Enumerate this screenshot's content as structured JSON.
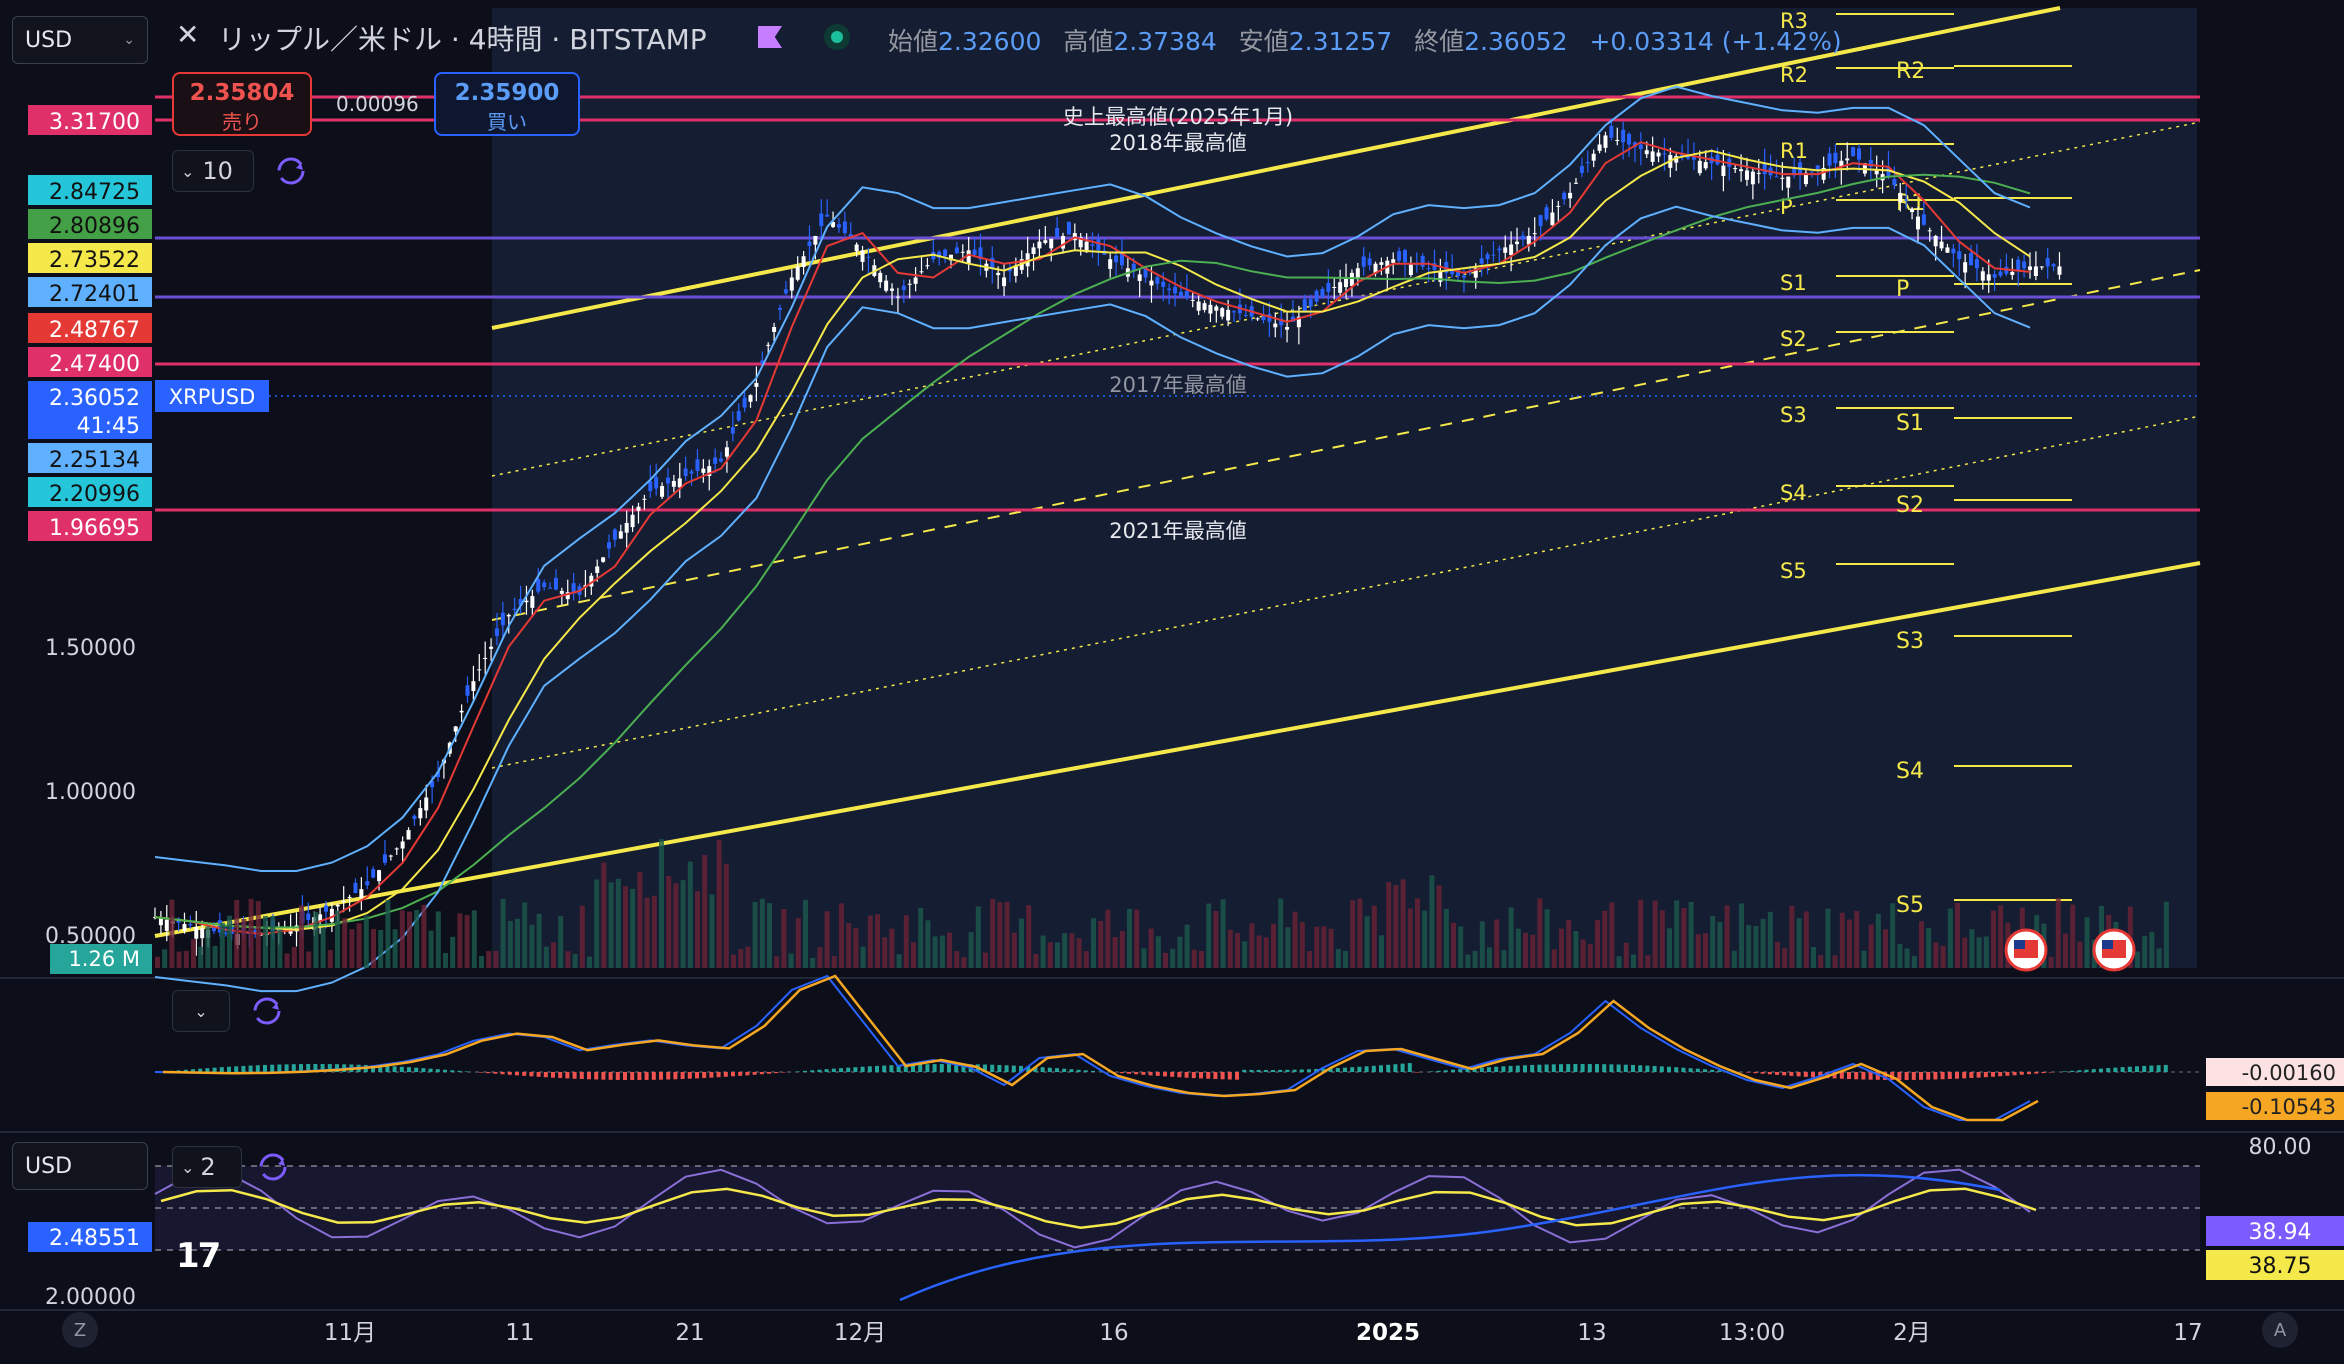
{
  "header": {
    "currency": "USD",
    "title": "リップル／米ドル · 4時間 · BITSTAMP",
    "ohlc": {
      "open_label": "始値",
      "open": "2.32600",
      "high_label": "高値",
      "high": "2.37384",
      "low_label": "安値",
      "low": "2.31257",
      "close_label": "終値",
      "close": "2.36052",
      "change": "+0.03314 (+1.42%)"
    },
    "sell": {
      "price": "2.35804",
      "label": "売り"
    },
    "buy": {
      "price": "2.35900",
      "label": "買い"
    },
    "spread": "0.00096",
    "interval_count": "10",
    "osc_currency": "USD",
    "osc_count": "2"
  },
  "colors": {
    "background": "#0c0f1a",
    "channel_line": "#f5e84a",
    "red_line": "#e0306a",
    "purple_line": "#6a4fd6",
    "bollinger": "#5fb0ff",
    "sma_fast": "#e53935",
    "sma_mid": "#f5e84a",
    "sma_slow": "#4caf50",
    "macd_signal": "#f5a623",
    "rsi": "#8a6fd6",
    "accent_blue": "#2962ff"
  },
  "chart_data": {
    "type": "candlestick",
    "symbol": "XRPUSD",
    "y_scale": "log",
    "y_ticks": [
      {
        "label": "3.31700",
        "value": 3.317,
        "color": "#e0306a"
      },
      {
        "label": "2.84725",
        "value": 2.84725,
        "color": "#26c6da"
      },
      {
        "label": "2.80896",
        "value": 2.80896,
        "color": "#43a047"
      },
      {
        "label": "2.73522",
        "value": 2.73522,
        "color": "#f5e84a"
      },
      {
        "label": "2.72401",
        "value": 2.72401,
        "color": "#5fb0ff"
      },
      {
        "label": "2.48767",
        "value": 2.48767,
        "color": "#e53935"
      },
      {
        "label": "2.47400",
        "value": 2.474,
        "color": "#e0306a"
      },
      {
        "label": "2.36052",
        "value": 2.36052,
        "color": "#2962ff"
      },
      {
        "label": "41:45",
        "value": 2.29,
        "color": "#2962ff"
      },
      {
        "label": "2.25134",
        "value": 2.25134,
        "color": "#5fb0ff"
      },
      {
        "label": "2.20996",
        "value": 2.20996,
        "color": "#26c6da"
      },
      {
        "label": "1.96695",
        "value": 1.96695,
        "color": "#e0306a"
      },
      {
        "label": "1.50000",
        "value": 1.5,
        "color": ""
      },
      {
        "label": "1.00000",
        "value": 1.0,
        "color": ""
      },
      {
        "label": "0.50000",
        "value": 0.5,
        "color": ""
      }
    ],
    "volume_label": "1.26 M",
    "x_ticks": [
      "11月",
      "11",
      "21",
      "12月",
      "16",
      "2025",
      "13",
      "13:00",
      "2月",
      "17"
    ],
    "horizontal_levels": [
      {
        "value": 3.317,
        "label": "史上最高値(2025年1月)",
        "color": "#e0306a"
      },
      {
        "value": 3.2,
        "label": "2018年最高値",
        "color": "#e0306a"
      },
      {
        "value": 2.85,
        "label": "",
        "color": "#6a4fd6"
      },
      {
        "value": 2.72,
        "label": "",
        "color": "#6a4fd6"
      },
      {
        "value": 2.474,
        "label": "2017年最高値",
        "color": "#e0306a"
      },
      {
        "value": 1.967,
        "label": "2021年最高値",
        "color": "#e0306a"
      }
    ],
    "pivot_labels": {
      "set1": [
        "R3",
        "R2",
        "R1",
        "P",
        "S1",
        "S2",
        "S3",
        "S4",
        "S5"
      ],
      "set2": [
        "R2",
        "R1",
        "P",
        "S1",
        "S2",
        "S3",
        "S4",
        "S5"
      ]
    },
    "series": [
      {
        "name": "XRPUSD",
        "close": [
          0.52,
          0.51,
          0.5,
          0.5,
          0.51,
          0.53,
          0.56,
          0.62,
          0.72,
          0.9,
          1.05,
          1.12,
          1.1,
          1.25,
          1.4,
          1.45,
          1.5,
          1.8,
          2.3,
          2.65,
          2.45,
          2.2,
          2.4,
          2.45,
          2.3,
          2.5,
          2.55,
          2.4,
          2.3,
          2.2,
          2.15,
          2.1,
          2.05,
          2.2,
          2.35,
          2.4,
          2.35,
          2.3,
          2.45,
          2.55,
          2.8,
          3.2,
          3.1,
          3.05,
          3.0,
          2.95,
          2.9,
          2.95,
          3.05,
          2.9,
          2.6,
          2.4,
          2.3,
          2.36
        ]
      }
    ],
    "macd": {
      "labels": [
        "-0.00160",
        "-0.10543"
      ]
    },
    "rsi": {
      "labels": [
        "80.00",
        "38.94",
        "38.75"
      ],
      "osc_price_label": "2.48551",
      "bottom_label": "2.00000"
    }
  }
}
